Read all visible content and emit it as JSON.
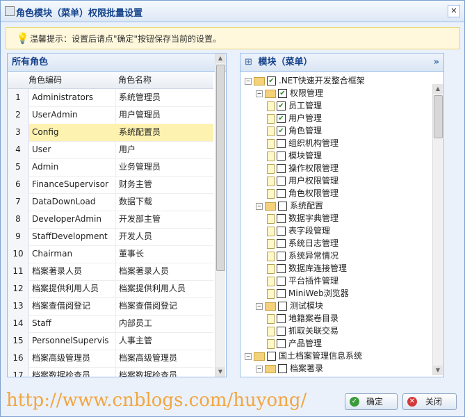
{
  "window": {
    "title": "角色模块（菜单）权限批量设置",
    "close_icon": "close-icon"
  },
  "tip": {
    "text": "温馨提示：设置后请点\"确定\"按钮保存当前的设置。",
    "icon": "lightbulb-icon"
  },
  "roles": {
    "panel_title": "所有角色",
    "columns": [
      "角色编码",
      "角色名称"
    ],
    "selected_index": 3,
    "rows": [
      {
        "num": "1",
        "code": "Administrators",
        "name": "系统管理员"
      },
      {
        "num": "2",
        "code": "UserAdmin",
        "name": "用户管理员"
      },
      {
        "num": "3",
        "code": "Config",
        "name": "系统配置员"
      },
      {
        "num": "4",
        "code": "User",
        "name": "用户"
      },
      {
        "num": "5",
        "code": "Admin",
        "name": "业务管理员"
      },
      {
        "num": "6",
        "code": "FinanceSupervisor",
        "name": "财务主管"
      },
      {
        "num": "7",
        "code": "DataDownLoad",
        "name": "数据下载"
      },
      {
        "num": "8",
        "code": "DeveloperAdmin",
        "name": "开发部主管"
      },
      {
        "num": "9",
        "code": "StaffDevelopment",
        "name": "开发人员"
      },
      {
        "num": "10",
        "code": "Chairman",
        "name": "董事长"
      },
      {
        "num": "11",
        "code": "档案著录人员",
        "name": "档案著录人员"
      },
      {
        "num": "12",
        "code": "档案提供利用人员",
        "name": "档案提供利用人员"
      },
      {
        "num": "13",
        "code": "档案查借阅登记",
        "name": "档案查借阅登记"
      },
      {
        "num": "14",
        "code": "Staff",
        "name": "内部员工"
      },
      {
        "num": "15",
        "code": "PersonnelSupervis",
        "name": "人事主管"
      },
      {
        "num": "16",
        "code": "档案高级管理员",
        "name": "档案高级管理员"
      },
      {
        "num": "17",
        "code": "档案数据检查员",
        "name": "档案数据检查员"
      }
    ]
  },
  "modules": {
    "panel_title": "模块（菜单）",
    "collapse_icon": "double-chevron-right-icon",
    "nodes": [
      {
        "label": ".NET快速开发整合框架",
        "level": 0,
        "folder": true,
        "checked": true
      },
      {
        "label": "权限管理",
        "level": 1,
        "folder": true,
        "checked": true
      },
      {
        "label": "员工管理",
        "level": 2,
        "folder": false,
        "checked": true
      },
      {
        "label": "用户管理",
        "level": 2,
        "folder": false,
        "checked": true
      },
      {
        "label": "角色管理",
        "level": 2,
        "folder": false,
        "checked": true
      },
      {
        "label": "组织机构管理",
        "level": 2,
        "folder": false,
        "checked": false
      },
      {
        "label": "模块管理",
        "level": 2,
        "folder": false,
        "checked": false
      },
      {
        "label": "操作权限管理",
        "level": 2,
        "folder": false,
        "checked": false
      },
      {
        "label": "用户权限管理",
        "level": 2,
        "folder": false,
        "checked": false
      },
      {
        "label": "角色权限管理",
        "level": 2,
        "folder": false,
        "checked": false
      },
      {
        "label": "系统配置",
        "level": 1,
        "folder": true,
        "checked": false
      },
      {
        "label": "数据字典管理",
        "level": 2,
        "folder": false,
        "checked": false
      },
      {
        "label": "表字段管理",
        "level": 2,
        "folder": false,
        "checked": false
      },
      {
        "label": "系统日志管理",
        "level": 2,
        "folder": false,
        "checked": false
      },
      {
        "label": "系统异常情况",
        "level": 2,
        "folder": false,
        "checked": false
      },
      {
        "label": "数据库连接管理",
        "level": 2,
        "folder": false,
        "checked": false
      },
      {
        "label": "平台插件管理",
        "level": 2,
        "folder": false,
        "checked": false
      },
      {
        "label": "MiniWeb浏览器",
        "level": 2,
        "folder": false,
        "checked": false
      },
      {
        "label": "测试模块",
        "level": 1,
        "folder": true,
        "checked": false
      },
      {
        "label": "地籍案卷目录",
        "level": 2,
        "folder": false,
        "checked": false
      },
      {
        "label": "抓取关联交易",
        "level": 2,
        "folder": false,
        "checked": false
      },
      {
        "label": "产品管理",
        "level": 2,
        "folder": false,
        "checked": false
      },
      {
        "label": "国土档案管理信息系统",
        "level": 0,
        "folder": true,
        "checked": false
      },
      {
        "label": "档案著录",
        "level": 1,
        "folder": true,
        "checked": false
      },
      {
        "label": "",
        "level": 2,
        "folder": false,
        "checked": false
      }
    ]
  },
  "buttons": {
    "ok_label": "确定",
    "close_label": "关闭"
  },
  "watermark": "http://www.cnblogs.com/huyong/"
}
